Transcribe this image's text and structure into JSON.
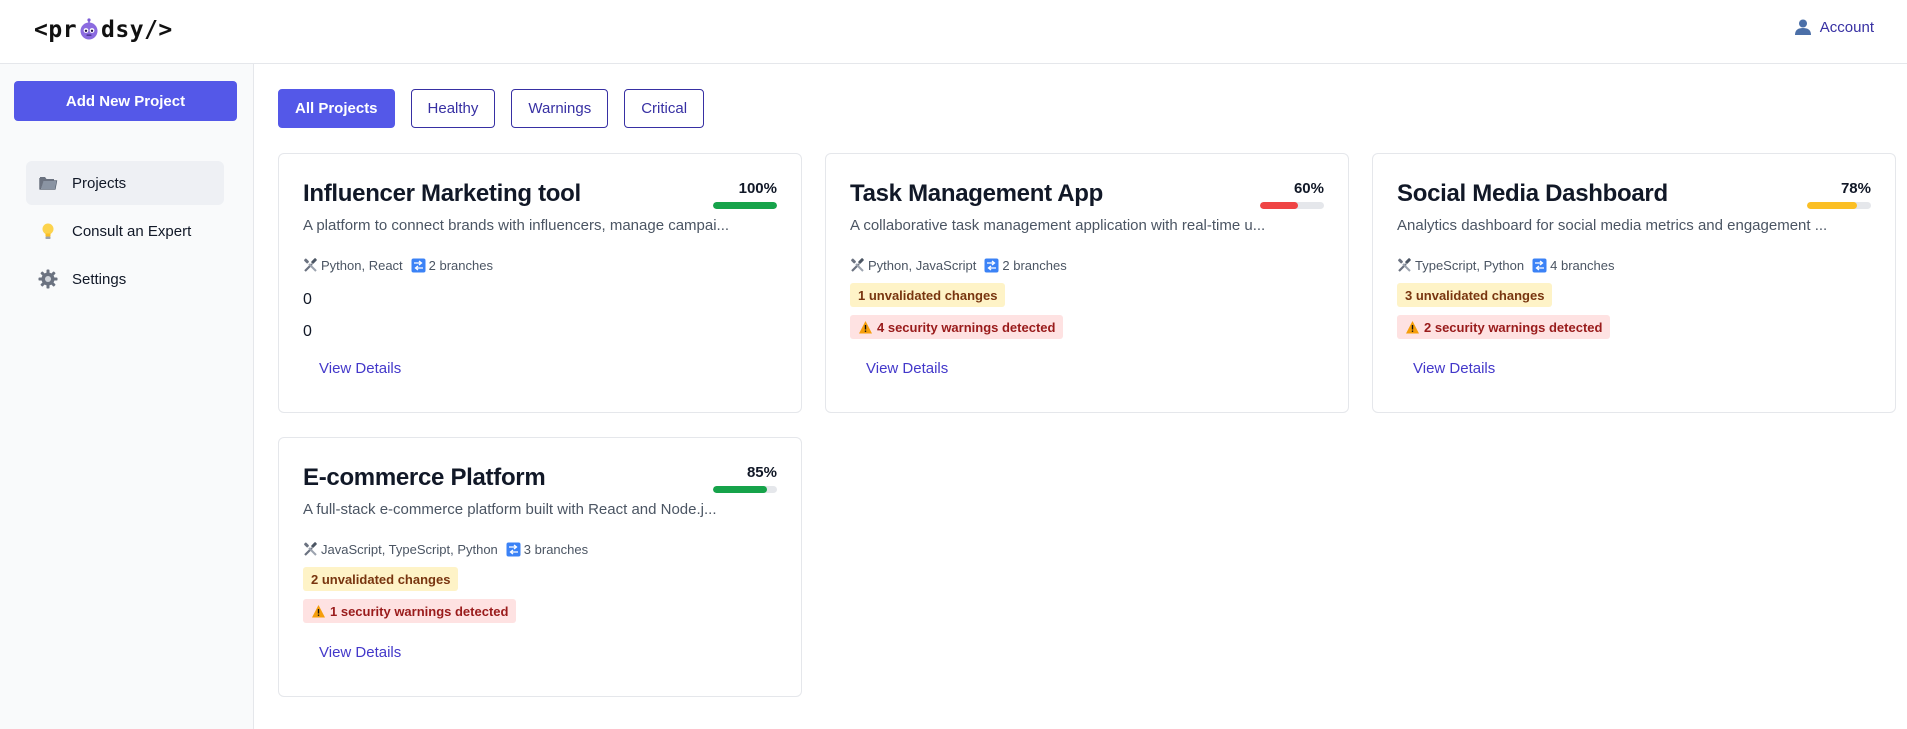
{
  "header": {
    "logo_left": "<pr",
    "logo_right": "dsy/>",
    "account_label": "Account"
  },
  "sidebar": {
    "add_button": "Add New Project",
    "items": [
      {
        "label": "Projects",
        "icon": "folder-icon",
        "active": true
      },
      {
        "label": "Consult an Expert",
        "icon": "lightbulb-icon",
        "active": false
      },
      {
        "label": "Settings",
        "icon": "gear-icon",
        "active": false
      }
    ]
  },
  "filters": [
    "All Projects",
    "Healthy",
    "Warnings",
    "Critical"
  ],
  "active_filter": "All Projects",
  "projects": [
    {
      "title": "Influencer Marketing tool",
      "description": "A platform to connect brands with influencers, manage campai...",
      "percent": "100%",
      "progress": 1.0,
      "bar_color": "#16a34a",
      "tech": "Python, React",
      "branches": "2 branches",
      "unvalidated": "0",
      "warnings": "0",
      "details": "View Details"
    },
    {
      "title": "Task Management App",
      "description": "A collaborative task management application with real-time u...",
      "percent": "60%",
      "progress": 0.6,
      "bar_color": "#ef4444",
      "tech": "Python, JavaScript",
      "branches": "2 branches",
      "unvalidated": "1 unvalidated changes",
      "warnings": "4 security warnings detected",
      "details": "View Details"
    },
    {
      "title": "Social Media Dashboard",
      "description": "Analytics dashboard for social media metrics and engagement ...",
      "percent": "78%",
      "progress": 0.78,
      "bar_color": "#fbbf24",
      "tech": "TypeScript, Python",
      "branches": "4 branches",
      "unvalidated": "3 unvalidated changes",
      "warnings": "2 security warnings detected",
      "details": "View Details"
    },
    {
      "title": "E-commerce Platform",
      "description": "A full-stack e-commerce platform built with React and Node.j...",
      "percent": "85%",
      "progress": 0.85,
      "bar_color": "#16a34a",
      "tech": "JavaScript, TypeScript, Python",
      "branches": "3 branches",
      "unvalidated": "2 unvalidated changes",
      "warnings": "1 security warnings detected",
      "details": "View Details"
    }
  ]
}
